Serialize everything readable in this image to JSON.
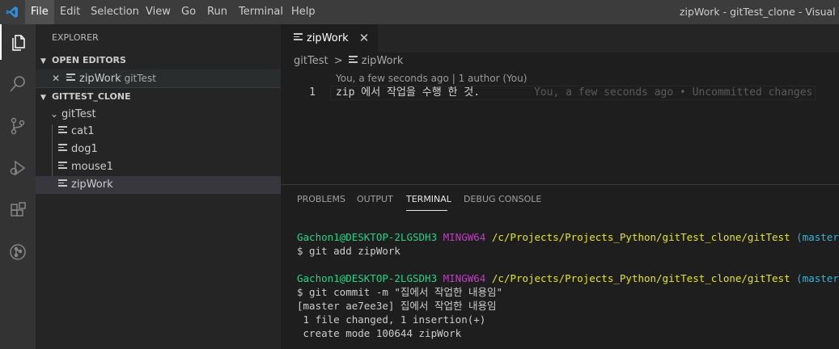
{
  "menubar": {
    "items": [
      "File",
      "Edit",
      "Selection",
      "View",
      "Go",
      "Run",
      "Terminal",
      "Help"
    ],
    "window_title": "zipWork - gitTest_clone - Visual Studio"
  },
  "sidebar": {
    "title": "EXPLORER",
    "open_editors": {
      "header": "OPEN EDITORS",
      "items": [
        {
          "close": "✕",
          "name": "zipWork",
          "description": "gitTest"
        }
      ]
    },
    "workspace": {
      "header": "GITTEST_CLONE",
      "folder": "gitTest",
      "files": [
        "cat1",
        "dog1",
        "mouse1",
        "zipWork"
      ]
    }
  },
  "editor": {
    "tab": {
      "label": "zipWork",
      "close": "✕"
    },
    "breadcrumb": {
      "folder": "gitTest",
      "separator": ">",
      "file": "zipWork"
    },
    "codelens": "You, a few seconds ago | 1 author (You)",
    "lines": [
      {
        "number": "1",
        "text": "zip 에서 작업을 수행 한 것.",
        "blame": "You, a few seconds ago • Uncommitted changes"
      }
    ]
  },
  "panel": {
    "tabs": [
      "PROBLEMS",
      "OUTPUT",
      "TERMINAL",
      "DEBUG CONSOLE"
    ],
    "active_tab": "TERMINAL"
  },
  "terminal": {
    "prompt_user": "Gachon1@DESKTOP-2LGSDH3",
    "prompt_env": "MINGW64",
    "prompt_path": "/c/Projects/Projects_Python/gitTest_clone/gitTest",
    "prompt_branch": "(master)",
    "cmd1": "$ git add zipWork",
    "cmd2": "$ git commit -m \"집에서 작업한 내용임\"",
    "out1": "[master ae7ee3e] 집에서 작업한 내용임",
    "out2": " 1 file changed, 1 insertion(+)",
    "out3": " create mode 100644 zipWork"
  },
  "colors": {
    "activity_bar": "#333333",
    "sidebar": "#252526",
    "editor": "#1e1e1e",
    "title_bar": "#3c3c3c",
    "vscode_blue": "#2d8fe0",
    "terminal_green": "#23d18b",
    "terminal_magenta": "#bc3fbc",
    "terminal_yellow": "#e5e510",
    "terminal_cyan": "#29b8db"
  },
  "icons": [
    "vscode-logo",
    "explorer-icon",
    "search-icon",
    "source-control-icon",
    "run-debug-icon",
    "extensions-icon",
    "git-graph-icon",
    "file-icon",
    "chevron-down-icon",
    "close-icon"
  ]
}
